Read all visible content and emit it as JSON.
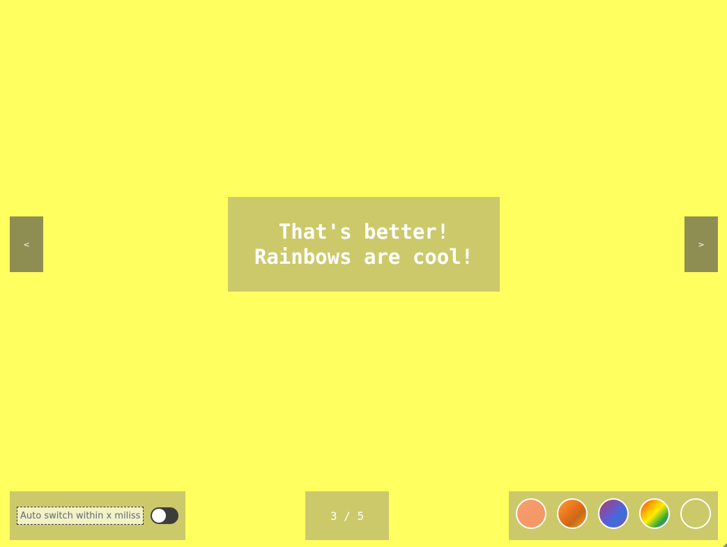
{
  "slide": {
    "text": "That's better!\nRainbows are cool!"
  },
  "nav": {
    "prev_label": "<",
    "next_label": ">"
  },
  "auto_switch": {
    "placeholder": "Auto switch within x milissec",
    "value": "",
    "enabled": false
  },
  "counter": {
    "text": "3 / 5"
  },
  "themes": [
    {
      "name": "peach",
      "colors": [
        "#f6a36b",
        "#ee9c5e"
      ]
    },
    {
      "name": "orange",
      "colors": [
        "#f9a12a",
        "#c76a14"
      ]
    },
    {
      "name": "purple-blue",
      "colors": [
        "#b23a6a",
        "#3a6fd8"
      ]
    },
    {
      "name": "rainbow",
      "colors": [
        "#ff3a2a",
        "#ffee00",
        "#2a6ac8"
      ]
    },
    {
      "name": "olive",
      "colors": [
        "#cbc96a"
      ]
    }
  ],
  "colors": {
    "background": "#ffff5f",
    "panel": "#cbc96a",
    "nav_button": "#8f8e52",
    "text": "#ffffff"
  }
}
